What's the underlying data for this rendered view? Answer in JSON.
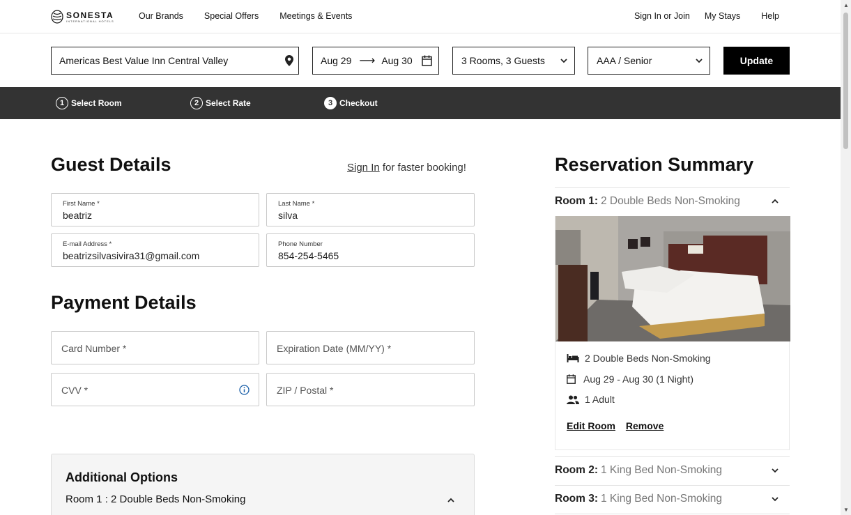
{
  "brand": {
    "name": "SONESTA",
    "sub": "INTERNATIONAL HOTELS"
  },
  "nav": {
    "left": [
      "Our Brands",
      "Special Offers",
      "Meetings & Events"
    ],
    "right": [
      "Sign In or Join",
      "My Stays",
      "Help"
    ]
  },
  "search": {
    "hotel": "Americas Best Value Inn Central Valley",
    "checkin": "Aug 29",
    "checkout": "Aug 30",
    "rooms_guests": "3 Rooms, 3 Guests",
    "rate": "AAA / Senior",
    "update_label": "Update"
  },
  "steps": [
    {
      "num": "1",
      "label": "Select Room"
    },
    {
      "num": "2",
      "label": "Select Rate"
    },
    {
      "num": "3",
      "label": "Checkout"
    }
  ],
  "guest": {
    "title": "Guest Details",
    "signin_link": "Sign In",
    "signin_rest": " for faster booking!",
    "first_name": {
      "label": "First Name *",
      "value": "beatriz"
    },
    "last_name": {
      "label": "Last Name *",
      "value": "silva"
    },
    "email": {
      "label": "E-mail Address *",
      "value": "beatrizsilvasivira31@gmail.com"
    },
    "phone": {
      "label": "Phone Number",
      "value": "854-254-5465"
    }
  },
  "payment": {
    "title": "Payment Details",
    "card": "Card Number *",
    "exp": "Expiration Date (MM/YY) *",
    "cvv": "CVV *",
    "zip": "ZIP / Postal *"
  },
  "additional": {
    "title": "Additional Options",
    "room": "Room 1 : 2 Double Beds Non-Smoking"
  },
  "summary": {
    "title": "Reservation Summary",
    "rooms": [
      {
        "label": "Room 1:",
        "name": "2 Double Beds Non-Smoking"
      },
      {
        "label": "Room 2:",
        "name": "1 King Bed Non-Smoking"
      },
      {
        "label": "Room 3:",
        "name": "1 King Bed Non-Smoking"
      }
    ],
    "details": {
      "beds": "2 Double Beds Non-Smoking",
      "dates": "Aug 29 - Aug 30 (1 Night)",
      "guests": "1 Adult"
    },
    "edit_label": "Edit Room",
    "remove_label": "Remove"
  },
  "colors": {
    "steps_bar": "#333333",
    "button": "#000000",
    "link_info": "#1a5fa8"
  }
}
